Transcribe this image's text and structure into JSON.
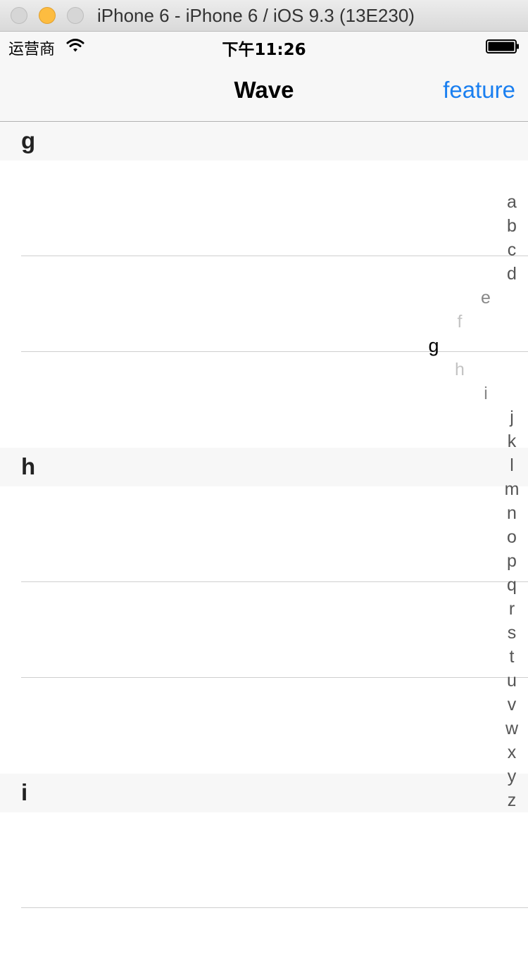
{
  "window": {
    "title": "iPhone 6 - iPhone 6 / iOS 9.3 (13E230)"
  },
  "status_bar": {
    "carrier": "运营商",
    "time": "下午11:26",
    "wifi_icon": "wifi-icon",
    "battery_icon": "battery-icon"
  },
  "nav": {
    "title": "Wave",
    "right_button": "feature"
  },
  "sections": [
    {
      "title": "g",
      "rows": 3
    },
    {
      "title": "h",
      "rows": 3
    },
    {
      "title": "i",
      "rows": 2
    }
  ],
  "index": {
    "letters": [
      "a",
      "b",
      "c",
      "d",
      "e",
      "f",
      "g",
      "h",
      "i",
      "j",
      "k",
      "l",
      "m",
      "n",
      "o",
      "p",
      "q",
      "r",
      "s",
      "t",
      "u",
      "v",
      "w",
      "x",
      "y",
      "z"
    ],
    "selected": "g"
  },
  "colors": {
    "accent": "#1a7ff0",
    "index_text": "#555555",
    "index_selected": "#000000",
    "section_bg": "#f7f7f7"
  }
}
